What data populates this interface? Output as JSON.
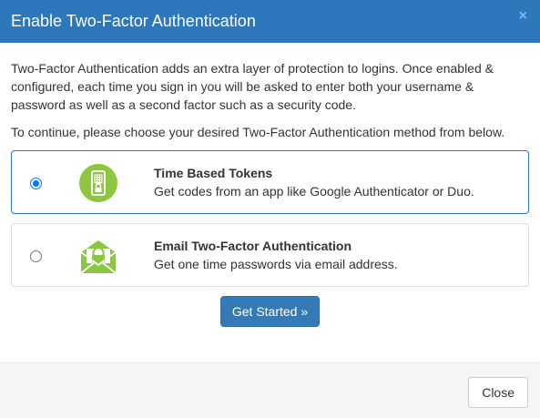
{
  "header": {
    "title": "Enable Two-Factor Authentication",
    "close_glyph": "×"
  },
  "body": {
    "intro": "Two-Factor Authentication adds an extra layer of protection to logins. Once enabled & configured, each time you sign in you will be asked to enter both your username & password as well as a second factor such as a security code.",
    "continue_text": "To continue, please choose your desired Two-Factor Authentication method from below."
  },
  "options": [
    {
      "title": "Time Based Tokens",
      "description": "Get codes from an app like Google Authenticator or Duo.",
      "selected": true,
      "icon": "mobile-lock-icon"
    },
    {
      "title": "Email Two-Factor Authentication",
      "description": "Get one time passwords via email address.",
      "selected": false,
      "icon": "email-lock-icon"
    }
  ],
  "actions": {
    "get_started_label": "Get Started »",
    "close_label": "Close"
  },
  "colors": {
    "header": "#2d77bb",
    "icon_green": "#8dc63f",
    "primary_button": "#337ab7",
    "footer_bg": "#f5f5f5"
  }
}
